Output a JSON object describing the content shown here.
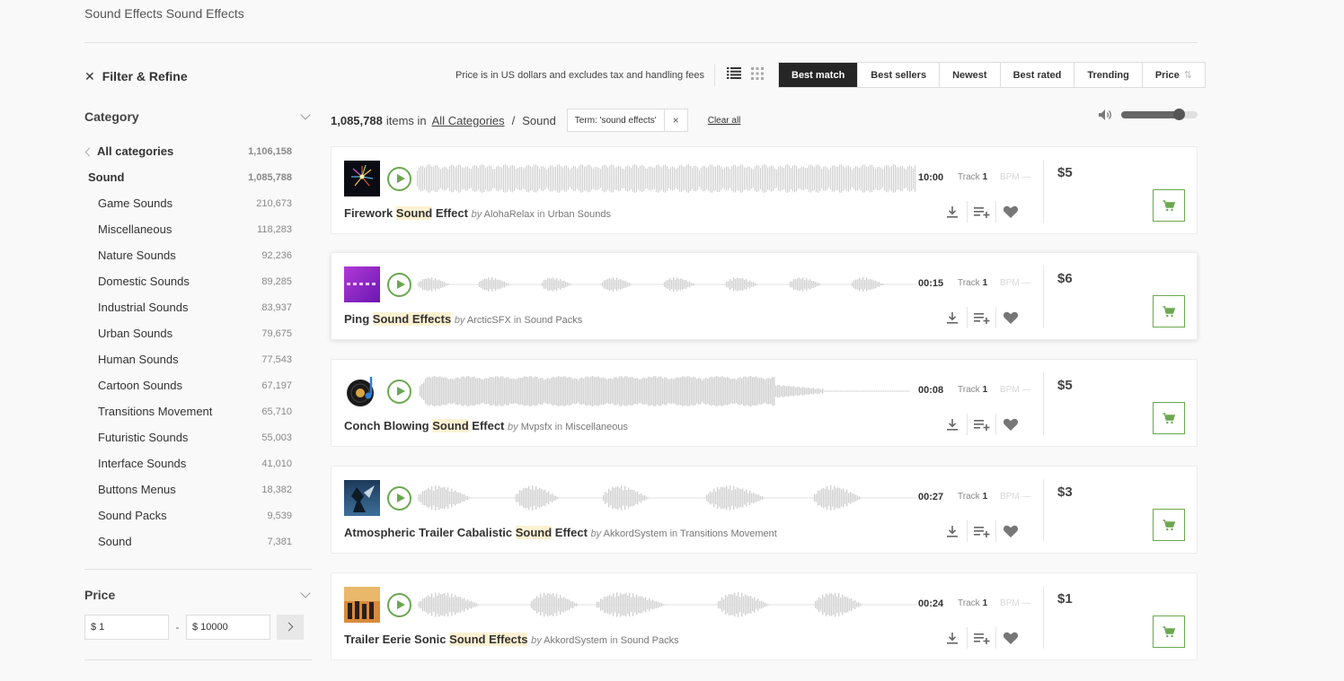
{
  "heading": "Sound Effects Sound Effects",
  "sidebar": {
    "filter_label": "Filter & Refine",
    "category_label": "Category",
    "all_categories": {
      "label": "All categories",
      "count": "1,106,158"
    },
    "current": {
      "label": "Sound",
      "count": "1,085,788"
    },
    "subcategories": [
      {
        "label": "Game Sounds",
        "count": "210,673"
      },
      {
        "label": "Miscellaneous",
        "count": "118,283"
      },
      {
        "label": "Nature Sounds",
        "count": "92,236"
      },
      {
        "label": "Domestic Sounds",
        "count": "89,285"
      },
      {
        "label": "Industrial Sounds",
        "count": "83,937"
      },
      {
        "label": "Urban Sounds",
        "count": "79,675"
      },
      {
        "label": "Human Sounds",
        "count": "77,543"
      },
      {
        "label": "Cartoon Sounds",
        "count": "67,197"
      },
      {
        "label": "Transitions Movement",
        "count": "65,710"
      },
      {
        "label": "Futuristic Sounds",
        "count": "55,003"
      },
      {
        "label": "Interface Sounds",
        "count": "41,010"
      },
      {
        "label": "Buttons Menus",
        "count": "18,382"
      },
      {
        "label": "Sound Packs",
        "count": "9,539"
      },
      {
        "label": "Sound",
        "count": "7,381"
      }
    ],
    "price_label": "Price",
    "price_min": "$ 1",
    "price_max": "$ 10000",
    "price_dash": "-"
  },
  "toolbar": {
    "price_note": "Price is in US dollars and excludes tax and handling fees",
    "sort_options": [
      "Best match",
      "Best sellers",
      "Newest",
      "Best rated",
      "Trending",
      "Price"
    ],
    "sort_active": "Best match",
    "price_sort_arrows": "⇅"
  },
  "results": {
    "count": "1,085,788",
    "items_in": "items in",
    "all_categories_link": "All Categories",
    "separator": "/",
    "crumb": "Sound",
    "term": "Term: 'sound effects'",
    "term_remove": "×",
    "clear_all": "Clear all"
  },
  "volume": {
    "level": 0.75
  },
  "items": [
    {
      "pre": "Firework ",
      "hl": "Sound",
      "post": " Effect",
      "author": "AlohaRelax",
      "category": "Urban Sounds",
      "duration": "10:00",
      "track_label": "Track",
      "track": "1",
      "bpm": "BPM —",
      "price": "$5"
    },
    {
      "pre": "Ping ",
      "hl": "Sound Effects",
      "post": "",
      "author": "ArcticSFX",
      "category": "Sound Packs",
      "duration": "00:15",
      "track_label": "Track",
      "track": "1",
      "bpm": "BPM —",
      "price": "$6"
    },
    {
      "pre": "Conch Blowing ",
      "hl": "Sound",
      "post": " Effect",
      "author": "Mvpsfx",
      "category": "Miscellaneous",
      "duration": "00:08",
      "track_label": "Track",
      "track": "1",
      "bpm": "BPM —",
      "price": "$5"
    },
    {
      "pre": "Atmospheric Trailer Cabalistic ",
      "hl": "Sound",
      "post": " Effect",
      "author": "AkkordSystem",
      "category": "Transitions Movement",
      "duration": "00:27",
      "track_label": "Track",
      "track": "1",
      "bpm": "BPM —",
      "price": "$3"
    },
    {
      "pre": "Trailer Eerie Sonic ",
      "hl": "Sound Effects",
      "post": "",
      "author": "AkkordSystem",
      "category": "Sound Packs",
      "duration": "00:24",
      "track_label": "Track",
      "track": "1",
      "bpm": "BPM —",
      "price": "$1"
    }
  ],
  "by_word": "by",
  "in_word": "in",
  "colors": {
    "accent": "#6aa84f",
    "active_sort": "#262626",
    "highlight": "#fdf1d2"
  }
}
